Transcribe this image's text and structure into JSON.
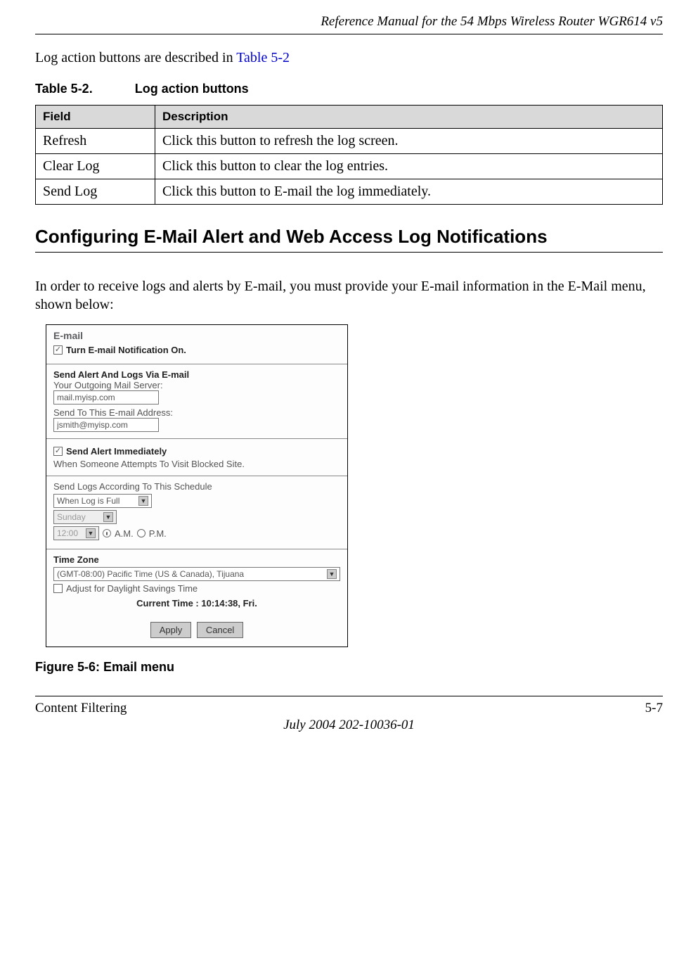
{
  "header": "Reference Manual for the 54 Mbps Wireless Router WGR614 v5",
  "intro_prefix": "Log action buttons are described in ",
  "intro_link": "Table 5-2",
  "table": {
    "caption_num": "Table 5-2.",
    "caption_title": "Log action buttons",
    "headers": [
      "Field",
      "Description"
    ],
    "rows": [
      {
        "field": "Refresh",
        "desc": "Click this button to refresh the log screen."
      },
      {
        "field": "Clear Log",
        "desc": "Click this button to clear the log entries."
      },
      {
        "field": "Send Log",
        "desc": "Click this button to E-mail the log immediately."
      }
    ]
  },
  "section_heading": "Configuring E-Mail Alert and Web Access Log Notifications",
  "para": "In order to receive logs and alerts by E-mail, you must provide your E-mail information in the E-Mail menu, shown below:",
  "panel": {
    "title": "E-mail",
    "turn_on_label": "Turn E-mail Notification On.",
    "send_section_title": "Send Alert And Logs Via E-mail",
    "outgoing_label": "Your Outgoing Mail Server:",
    "outgoing_value": "mail.myisp.com",
    "sendto_label": "Send To This E-mail Address:",
    "sendto_value": "jsmith@myisp.com",
    "alert_immediate_label": "Send Alert Immediately",
    "alert_when": "When Someone Attempts To Visit Blocked Site.",
    "schedule_label": "Send Logs According To This Schedule",
    "schedule_value": "When Log is Full",
    "day_value": "Sunday",
    "time_value": "12:00",
    "am_label": "A.M.",
    "pm_label": "P.M.",
    "tz_title": "Time Zone",
    "tz_value": "(GMT-08:00) Pacific Time (US & Canada), Tijuana",
    "dst_label": "Adjust for Daylight Savings Time",
    "current_time": "Current Time : 10:14:38, Fri.",
    "apply": "Apply",
    "cancel": "Cancel"
  },
  "figure_caption": "Figure 5-6:  Email menu",
  "footer_left": "Content Filtering",
  "footer_right": "5-7",
  "footer_date": "July 2004 202-10036-01"
}
